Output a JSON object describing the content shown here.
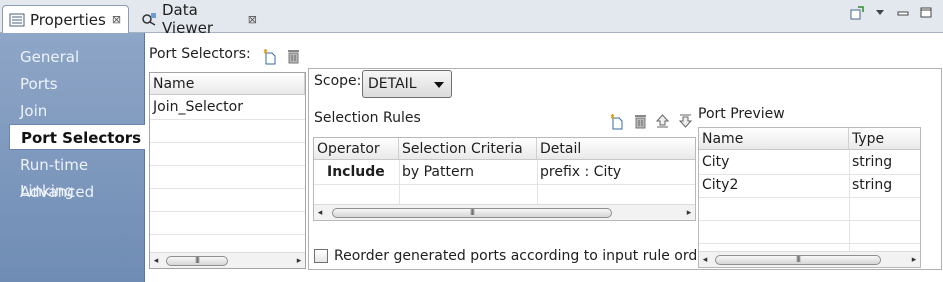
{
  "tabs": [
    {
      "label": "Properties",
      "active": true
    },
    {
      "label": "Data Viewer",
      "active": false
    }
  ],
  "tab_close_glyph": "⊠",
  "nav": {
    "items": [
      {
        "label": "General",
        "selected": false
      },
      {
        "label": "Ports",
        "selected": false
      },
      {
        "label": "Join",
        "selected": false
      },
      {
        "label": "Port Selectors",
        "selected": true
      },
      {
        "label": "Run-time Linking",
        "selected": false
      },
      {
        "label": "Advanced",
        "selected": false
      }
    ]
  },
  "port_selectors": {
    "label": "Port Selectors:",
    "column_header": "Name",
    "rows": [
      "Join_Selector"
    ]
  },
  "scope": {
    "label": "Scope:",
    "value": "DETAIL"
  },
  "selection_rules": {
    "label": "Selection Rules",
    "columns": [
      "Operator",
      "Selection Criteria",
      "Detail"
    ],
    "rows": [
      {
        "operator": "Include",
        "criteria": "by Pattern",
        "detail": "prefix : City"
      }
    ]
  },
  "port_preview": {
    "label": "Port Preview",
    "columns": [
      "Name",
      "Type"
    ],
    "rows": [
      {
        "name": "City",
        "type": "string"
      },
      {
        "name": "City2",
        "type": "string"
      }
    ]
  },
  "reorder_checkbox": {
    "label": "Reorder generated ports according to input rule order",
    "checked": false
  },
  "scroll_glyphs": {
    "left": "◂",
    "right": "▸",
    "grip": "III"
  },
  "colors": {
    "nav_background": "#7f99bf",
    "tab_strip": "#e3e7ee",
    "border": "#a4a4a4"
  }
}
